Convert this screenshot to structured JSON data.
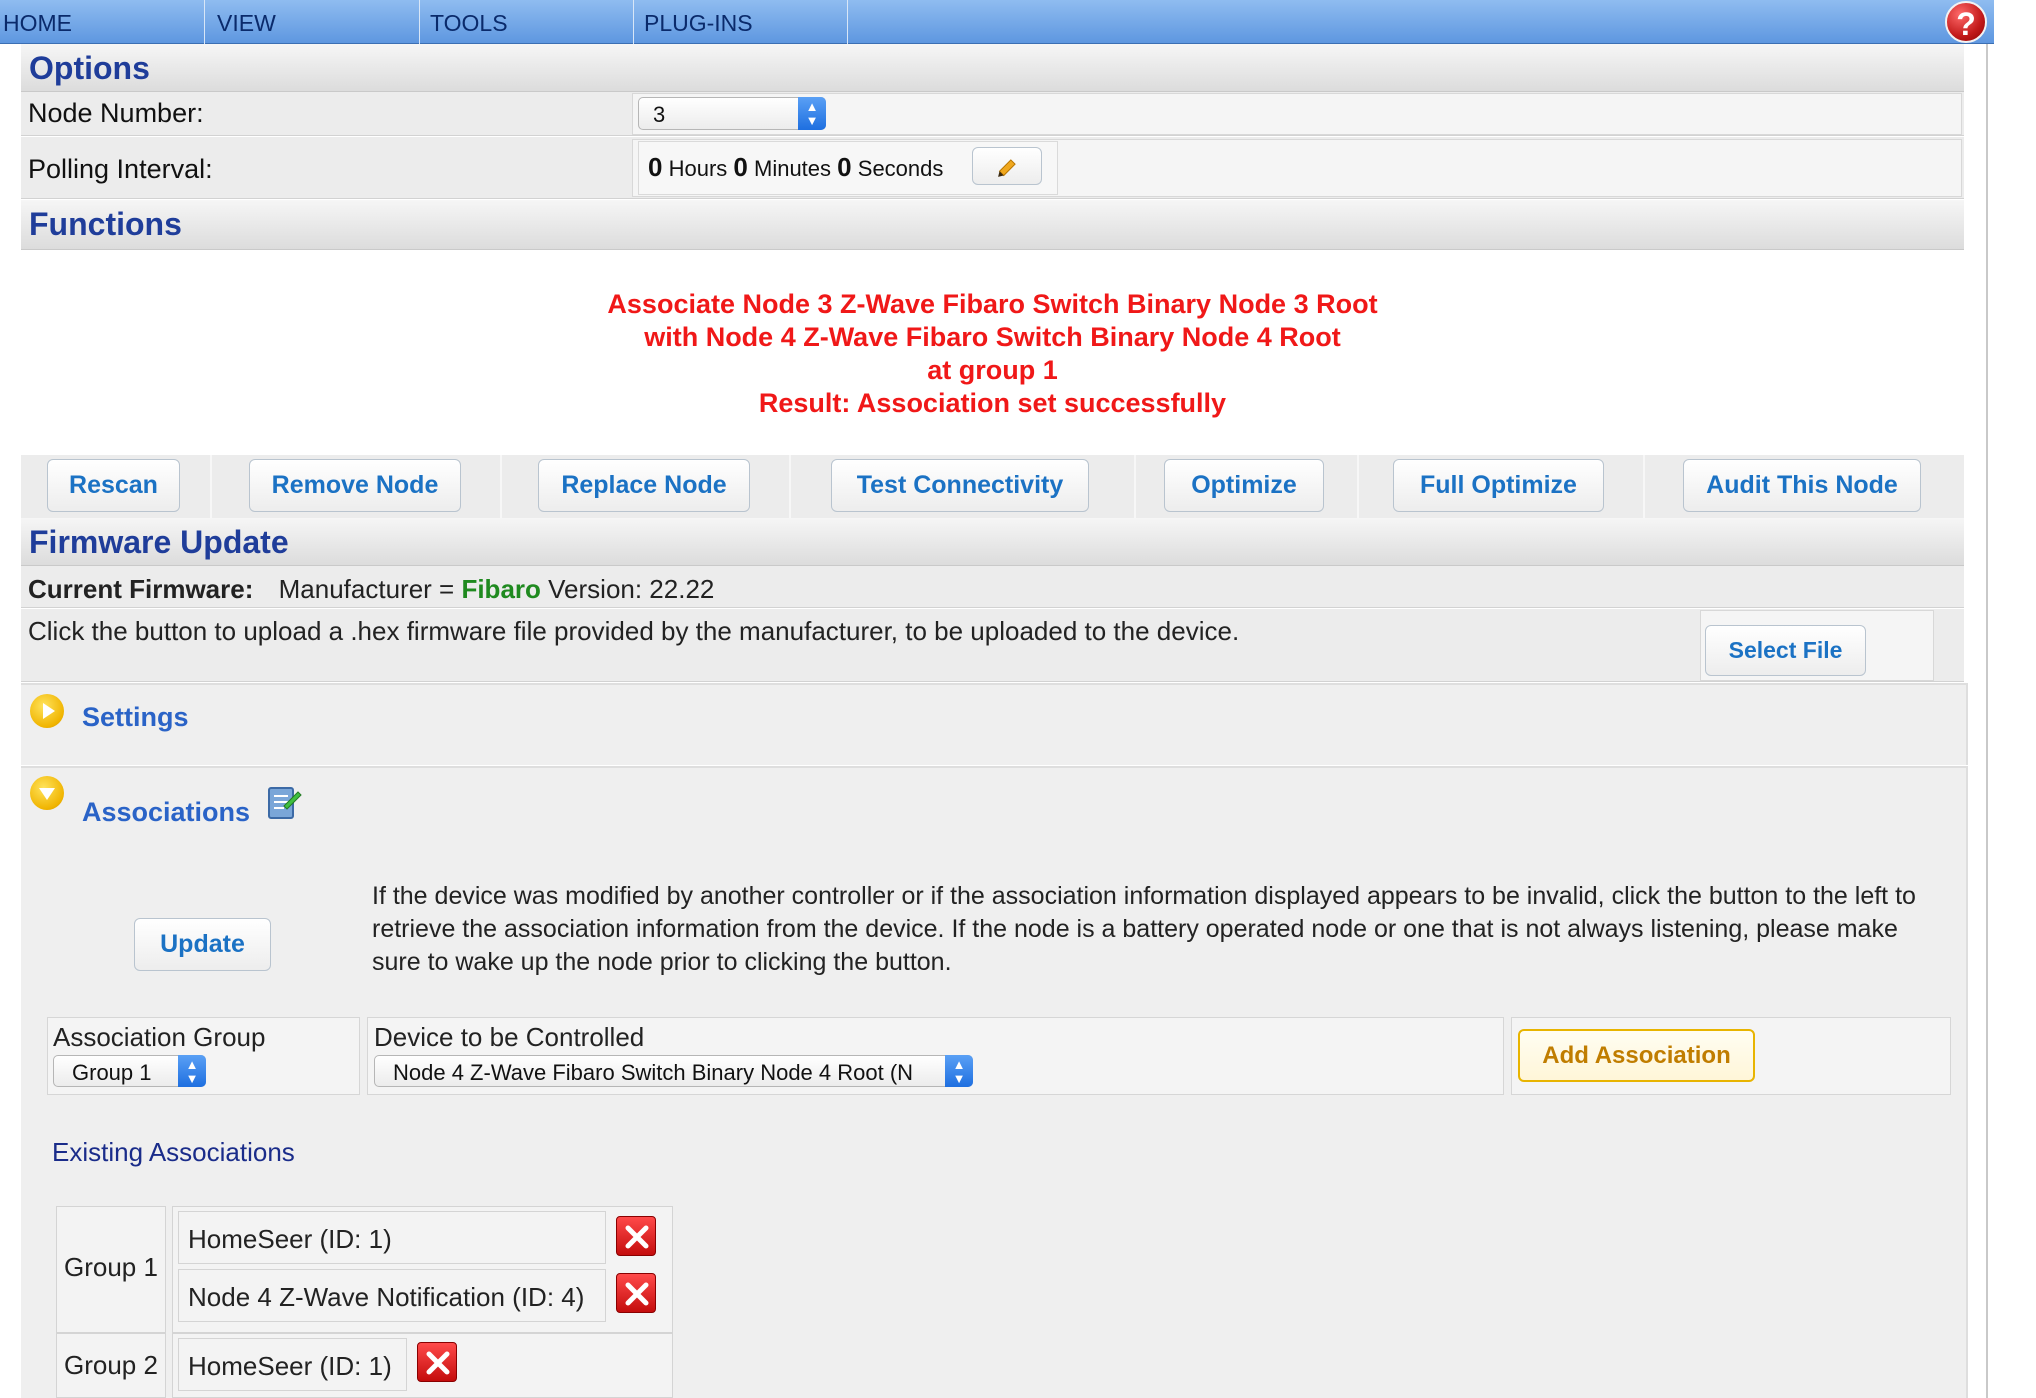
{
  "nav": {
    "items": [
      "HOME",
      "VIEW",
      "TOOLS",
      "PLUG-INS"
    ],
    "help_label": "?"
  },
  "options": {
    "title": "Options",
    "node_number_label": "Node Number:",
    "node_number_value": "3",
    "polling_label": "Polling Interval:",
    "polling": {
      "hours": "0",
      "hours_unit": "Hours",
      "minutes": "0",
      "minutes_unit": "Minutes",
      "seconds": "0",
      "seconds_unit": "Seconds"
    },
    "edit_icon": "pencil-icon"
  },
  "functions": {
    "title": "Functions",
    "result_lines": [
      "Associate Node 3 Z-Wave Fibaro Switch Binary Node 3 Root",
      "with Node 4 Z-Wave Fibaro Switch Binary Node 4 Root",
      "at group 1",
      "Result: Association set successfully"
    ],
    "buttons": [
      "Rescan",
      "Remove Node",
      "Replace Node",
      "Test Connectivity",
      "Optimize",
      "Full Optimize",
      "Audit This Node"
    ]
  },
  "firmware": {
    "title": "Firmware Update",
    "current_label": "Current Firmware:",
    "manufacturer_prefix": "Manufacturer =",
    "manufacturer": "Fibaro",
    "version_text": "Version: 22.22",
    "instructions": "Click the button to upload a .hex firmware file provided by the manufacturer, to be uploaded to the device.",
    "select_file_label": "Select File"
  },
  "settings": {
    "title": "Settings",
    "expanded": false
  },
  "associations": {
    "title": "Associations",
    "expanded": true,
    "update_label": "Update",
    "description": "If the device was modified by another controller or if the association information displayed appears to be invalid, click the button to the left to retrieve the association information from the device. If the node is a battery operated node or one that is not always listening, please make sure to wake up the node prior to clicking the button.",
    "group_label": "Association Group",
    "group_value": "Group 1",
    "device_label": "Device to be Controlled",
    "device_value": "Node 4 Z-Wave Fibaro Switch Binary Node 4 Root (N",
    "add_label": "Add Association",
    "existing_title": "Existing Associations",
    "existing": [
      {
        "group": "Group 1",
        "members": [
          "HomeSeer (ID: 1)",
          "Node 4 Z-Wave Notification (ID: 4)"
        ]
      },
      {
        "group": "Group 2",
        "members": [
          "HomeSeer (ID: 1)"
        ]
      }
    ]
  },
  "colors": {
    "nav_top": "#8fbcf0",
    "header_text": "#1f3d9a",
    "result_text": "#f01818",
    "button_text": "#1b72c4",
    "manufacturer": "#1f8a1f",
    "add_border": "#e8b400",
    "add_text": "#c07d00"
  }
}
